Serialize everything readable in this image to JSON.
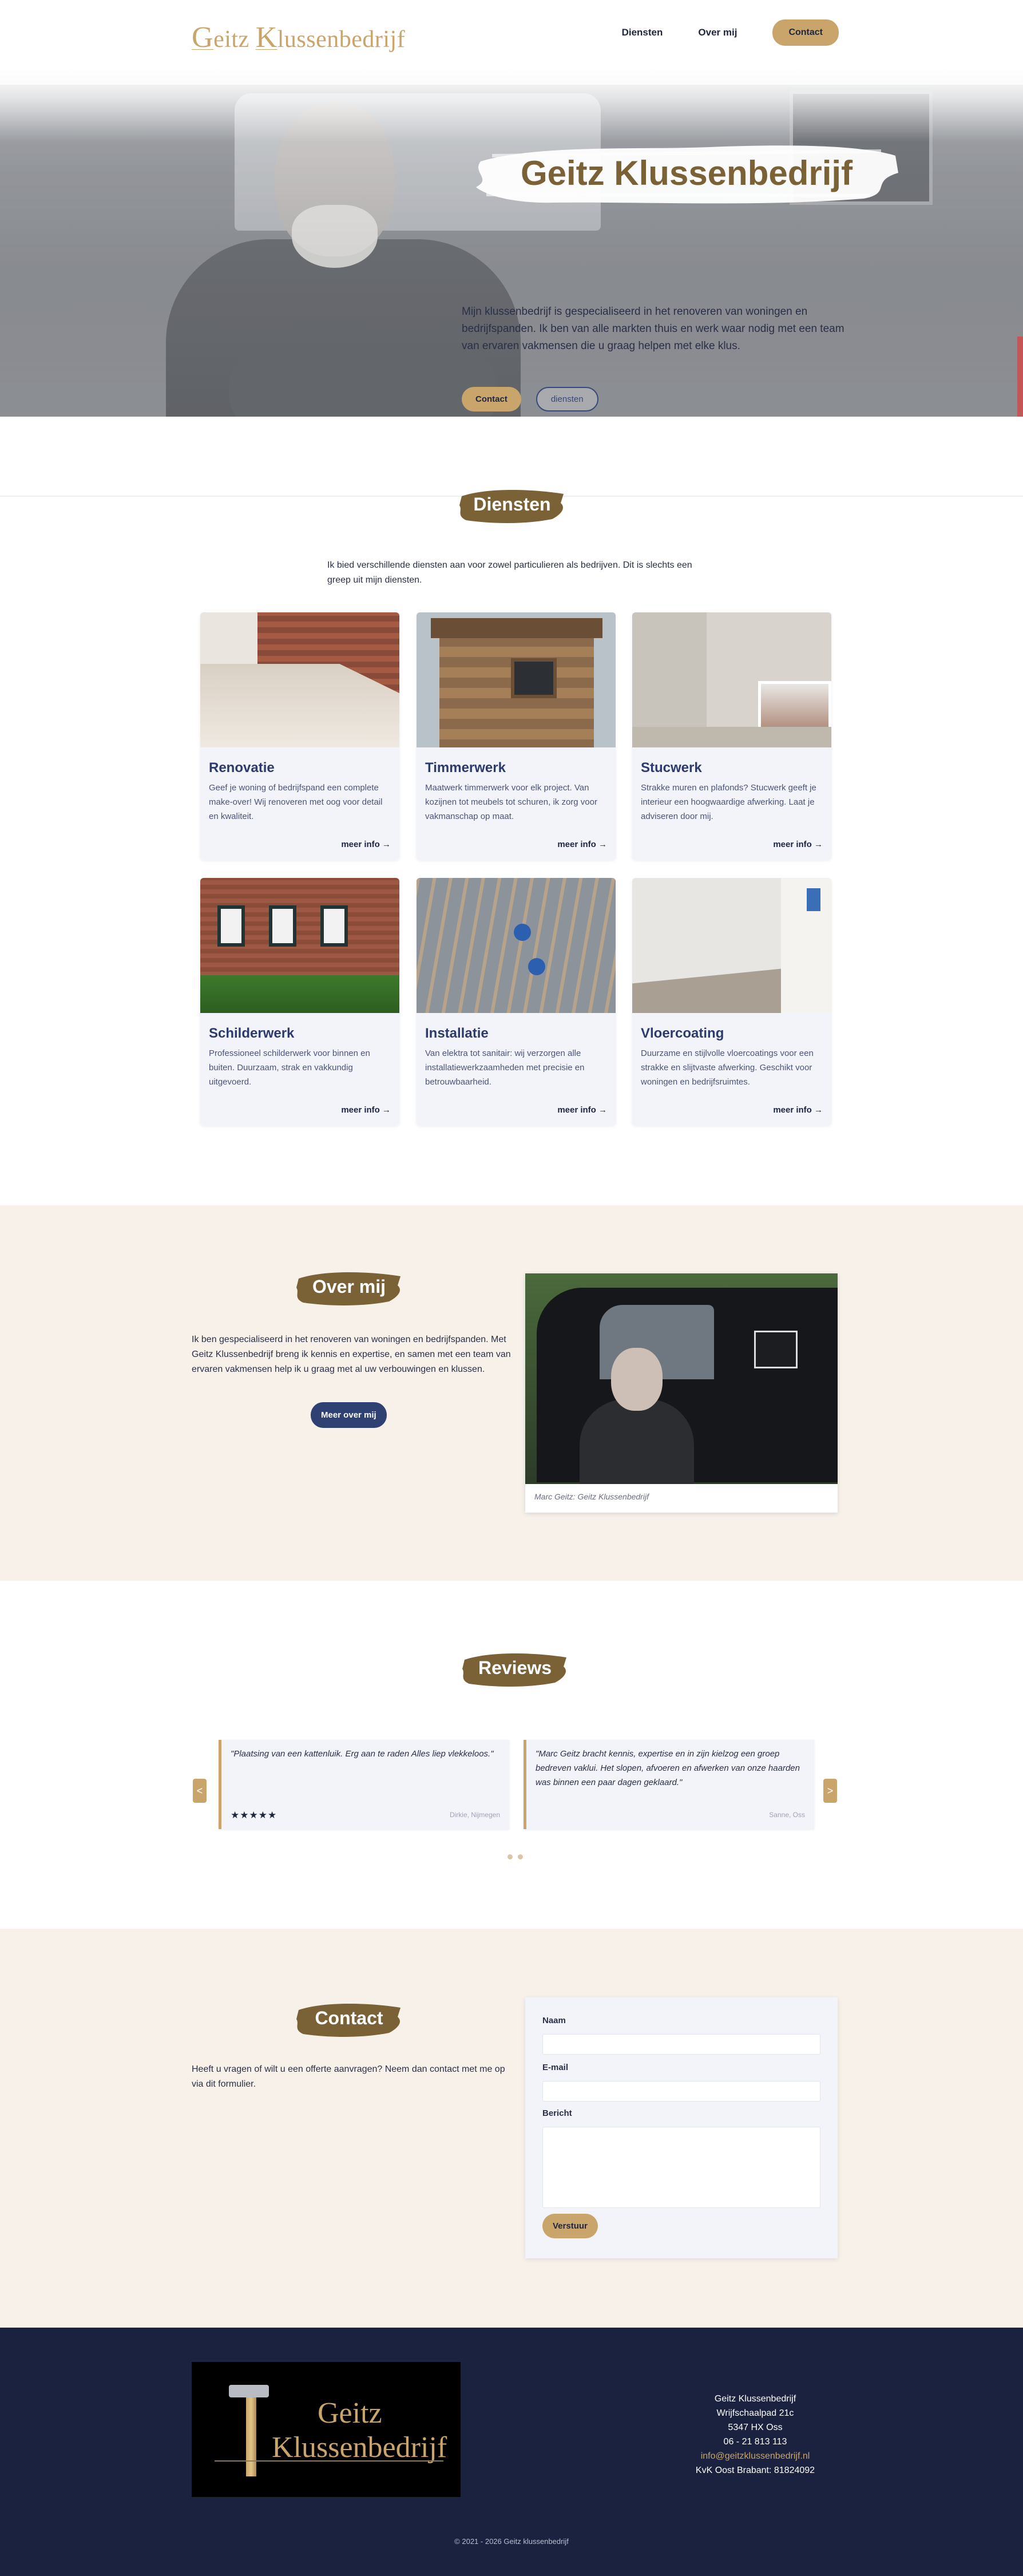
{
  "header": {
    "logo_first": "G",
    "logo_first_rest": "eitz ",
    "logo_second": "K",
    "logo_second_rest": "lussenbedrijf",
    "nav": {
      "diensten": "Diensten",
      "over": "Over mij",
      "contact": "Contact"
    }
  },
  "hero": {
    "title": "Geitz Klussenbedrijf",
    "text": "Mijn klussenbedrijf is gespecialiseerd in het renoveren van woningen en bedrijfspanden. Ik ben van alle markten thuis en werk waar nodig met een team van ervaren vakmensen die u graag helpen met elke klus.",
    "btn_contact": "Contact",
    "btn_diensten": "diensten"
  },
  "diensten": {
    "heading": "Diensten",
    "intro": "Ik bied verschillende diensten aan voor zowel particulieren als bedrijven. Dit is slechts een greep uit mijn diensten.",
    "more_label": "meer info →",
    "cards": [
      {
        "title": "Renovatie",
        "text": "Geef je woning of bedrijfspand een complete make-over! Wij renoveren met oog voor detail en kwaliteit."
      },
      {
        "title": "Timmerwerk",
        "text": "Maatwerk timmerwerk voor elk project. Van kozijnen tot meubels tot schuren, ik zorg voor vakmanschap op maat."
      },
      {
        "title": "Stucwerk",
        "text": "Strakke muren en plafonds? Stucwerk geeft je interieur een hoogwaardige afwerking. Laat je adviseren door mij."
      },
      {
        "title": "Schilderwerk",
        "text": "Professioneel schilderwerk voor binnen en buiten. Duurzaam, strak en vakkundig uitgevoerd."
      },
      {
        "title": "Installatie",
        "text": "Van elektra tot sanitair: wij verzorgen alle installatiewerkzaamheden met precisie en betrouwbaarheid."
      },
      {
        "title": "Vloercoating",
        "text": "Duurzame en stijlvolle vloercoatings voor een strakke en slijtvaste afwerking. Geschikt voor woningen en bedrijfsruimtes."
      }
    ]
  },
  "over": {
    "heading": "Over mij",
    "text": "Ik ben gespecialiseerd in het renoveren van woningen en bedrijfspanden. Met Geitz Klussenbedrijf breng ik kennis en expertise, en samen met een team van ervaren vakmensen help ik u graag met al uw verbouwingen en klussen.",
    "button": "Meer over mij",
    "caption": "Marc Geitz: Geitz Klussenbedrijf"
  },
  "reviews": {
    "heading": "Reviews",
    "prev": "<",
    "next": ">",
    "items": [
      {
        "quote": "\"Plaatsing van een kattenluik. Erg aan te raden Alles liep vlekkeloos.\"",
        "stars": "★★★★★",
        "who": "Dirkie, Nijmegen"
      },
      {
        "quote": "\"Marc Geitz bracht kennis, expertise en in zijn kielzog een groep bedreven vaklui. Het slopen, afvoeren en afwerken van onze haarden was binnen een paar dagen geklaard.\"",
        "stars": "",
        "who": "Sanne, Oss"
      }
    ]
  },
  "contact": {
    "heading": "Contact",
    "text": "Heeft u vragen of wilt u een offerte aanvragen? Neem dan contact met me op via dit formulier.",
    "label_name": "Naam",
    "label_email": "E-mail",
    "label_message": "Bericht",
    "send": "Verstuur"
  },
  "footer": {
    "logo_line1": "Geitz",
    "logo_line2": "Klussenbedrijf",
    "company": "Geitz Klussenbedrijf",
    "street": "Wrijfschaalpad 21c",
    "city": "5347 HX Oss",
    "phone": "06 - 21 813 113",
    "email": "info@geitzklussenbedrijf.nl",
    "kvk": "KvK Oost Brabant: 81824092",
    "copyright": "© 2021 - 2026 Geitz klussenbedrijf"
  },
  "colors": {
    "gold": "#c9a56b",
    "navy": "#1a2240",
    "brush": "#7a6136",
    "beige": "#f7f1ea",
    "card": "#f3f4fa"
  }
}
